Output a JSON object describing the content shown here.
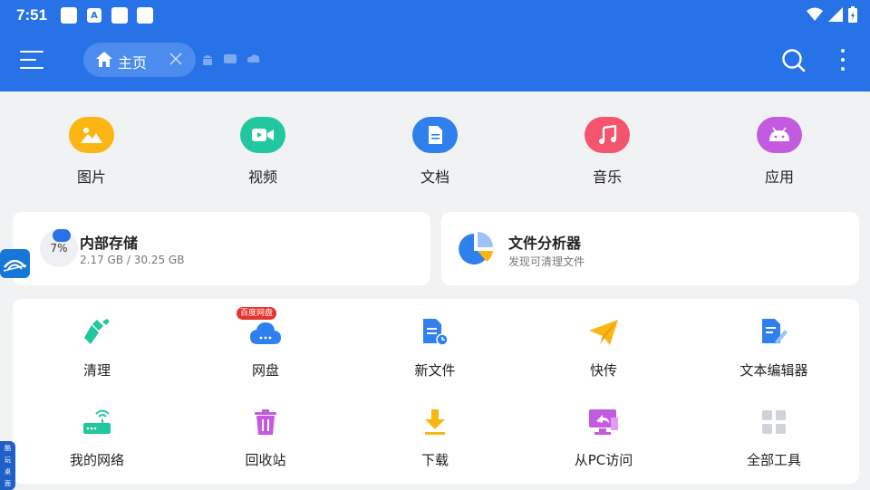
{
  "status_bar": {
    "time": "7:51",
    "notif_letter": "A"
  },
  "app_bar": {
    "home_tab_label": "主页"
  },
  "categories": [
    {
      "label": "图片",
      "icon": "image-icon",
      "color": "#fbb614"
    },
    {
      "label": "视频",
      "icon": "video-icon",
      "color": "#22c7a0"
    },
    {
      "label": "文档",
      "icon": "document-icon",
      "color": "#2f80ed"
    },
    {
      "label": "音乐",
      "icon": "music-icon",
      "color": "#f5546e"
    },
    {
      "label": "应用",
      "icon": "android-icon",
      "color": "#c35be0"
    }
  ],
  "storage": {
    "title": "内部存储",
    "usage": "2.17 GB / 30.25 GB",
    "percent_label": "7%"
  },
  "analyzer": {
    "title": "文件分析器",
    "subtitle": "发现可清理文件"
  },
  "tools": {
    "badge": "百度网盘",
    "items": [
      {
        "label": "清理",
        "icon": "broom-icon"
      },
      {
        "label": "网盘",
        "icon": "cloud-icon"
      },
      {
        "label": "新文件",
        "icon": "new-file-icon"
      },
      {
        "label": "快传",
        "icon": "send-icon"
      },
      {
        "label": "文本编辑器",
        "icon": "text-editor-icon"
      },
      {
        "label": "我的网络",
        "icon": "router-icon"
      },
      {
        "label": "回收站",
        "icon": "trash-icon"
      },
      {
        "label": "下载",
        "icon": "download-icon"
      },
      {
        "label": "从PC访问",
        "icon": "pc-access-icon"
      },
      {
        "label": "全部工具",
        "icon": "grid-icon"
      }
    ]
  },
  "float_tab_text": [
    "酷",
    "玩",
    "桌",
    "面"
  ],
  "colors": {
    "primary": "#2672e6",
    "background": "#f1f2f4"
  }
}
